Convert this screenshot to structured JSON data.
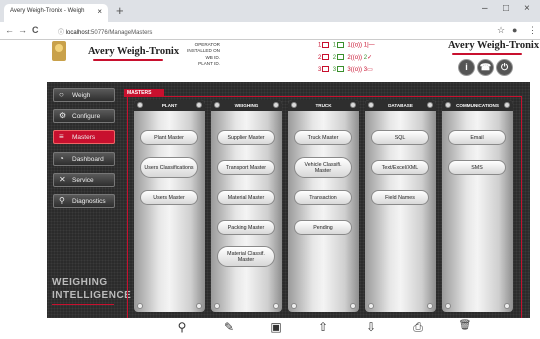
{
  "browser": {
    "tab_title": "Avery Weigh-Tronix - Weigh",
    "tab_close": "×",
    "new_tab": "+",
    "url_host": "localhost",
    "url_path": ":50776/ManageMasters",
    "back": "←",
    "forward": "→",
    "reload": "C",
    "info": "ⓘ",
    "star": "☆",
    "account": "●",
    "menu": "⋮",
    "minimize": "–",
    "maximize": "□",
    "close": "×"
  },
  "header": {
    "brand_left": "Avery Weigh-Tronix",
    "brand_right": "Avery Weigh-Tronix",
    "info_labels": [
      "OPERATOR",
      "INSTALLED ON",
      "WB ID.",
      "PLANT ID."
    ],
    "stations": [
      {
        "num": "1",
        "a": "1",
        "b": "1",
        "c": "1"
      },
      {
        "num": "2",
        "a": "2",
        "b": "2",
        "c": "2"
      },
      {
        "num": "3",
        "a": "3",
        "b": "3",
        "c": "3"
      }
    ],
    "buttons": {
      "info": "i",
      "support": "☎",
      "logout": "⏻"
    }
  },
  "sidebar": {
    "items": [
      {
        "label": "Weigh",
        "icon": "○"
      },
      {
        "label": "Configure",
        "icon": "⚙"
      },
      {
        "label": "Masters",
        "icon": "≡"
      },
      {
        "label": "Dashboard",
        "icon": "◔"
      },
      {
        "label": "Service",
        "icon": "✕"
      },
      {
        "label": "Diagnostics",
        "icon": "⚲"
      }
    ],
    "tagline_1": "WEIGHING",
    "tagline_2": "INTELLIGENCE"
  },
  "masters": {
    "tab_label": "MASTERS",
    "columns": [
      {
        "title": "PLANT",
        "items": [
          "Plant Master",
          "Users Classifications",
          "Users Master"
        ]
      },
      {
        "title": "WEIGHING",
        "items": [
          "Supplier Master",
          "Transport Master",
          "Material Master",
          "Packing Master",
          "Material Classif. Master"
        ]
      },
      {
        "title": "TRUCK",
        "items": [
          "Truck Master",
          "Vehicle Classifi. Master",
          "Transaction",
          "Pending"
        ]
      },
      {
        "title": "DATABASE",
        "items": [
          "SQL",
          "Text/Excel/XML",
          "Field Names"
        ]
      },
      {
        "title": "COMMUNICATIONS",
        "items": [
          "Email",
          "SMS"
        ]
      }
    ]
  },
  "toolbar": {
    "search": "⚲",
    "edit": "✎",
    "save": "▣",
    "upload": "⇧",
    "download": "⇩",
    "print": "⎙",
    "delete": "🗑"
  },
  "colors": {
    "accent": "#c8102e",
    "dark": "#2b2b2b"
  }
}
